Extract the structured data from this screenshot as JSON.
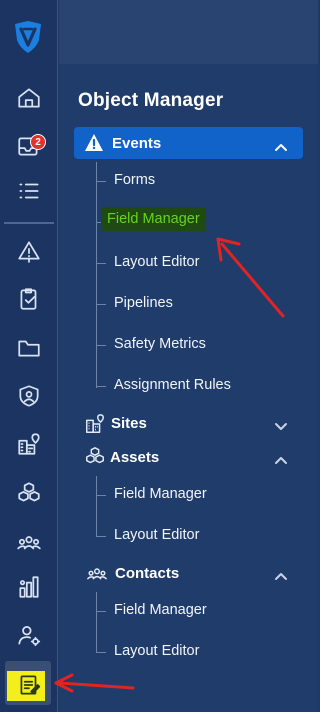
{
  "rail": {
    "logo": "shield-v-logo-icon",
    "badge_count": "2",
    "icons": [
      "home-icon",
      "inbox-icon",
      "list-icon",
      "alert-icon",
      "clipboard-check-icon",
      "folder-icon",
      "shield-user-icon",
      "building-pin-icon",
      "cubes-icon",
      "people-icon",
      "bar-chart-icon",
      "user-gear-icon",
      "edit-note-icon"
    ]
  },
  "panel": {
    "title": "Object Manager",
    "events": {
      "label": "Events",
      "items": [
        "Forms",
        "Field Manager",
        "Layout Editor",
        "Pipelines",
        "Safety Metrics",
        "Assignment Rules"
      ]
    },
    "sites": {
      "label": "Sites"
    },
    "assets": {
      "label": "Assets",
      "items": [
        "Field Manager",
        "Layout Editor"
      ]
    },
    "contacts": {
      "label": "Contacts",
      "items": [
        "Field Manager",
        "Layout Editor"
      ]
    }
  },
  "colors": {
    "accent": "#1163c9",
    "highlight_text": "#66d41e",
    "annotation_arrow": "#e02424",
    "annotation_highlight": "#f2ef1a"
  }
}
